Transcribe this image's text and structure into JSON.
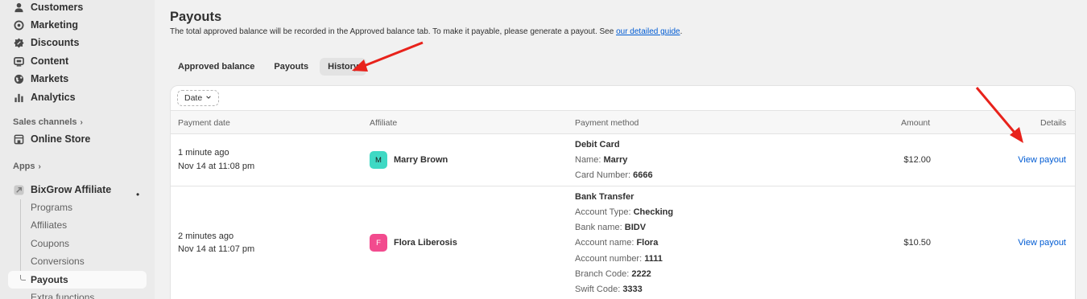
{
  "sidebar": {
    "items": [
      {
        "label": "Customers",
        "icon": "person-icon"
      },
      {
        "label": "Marketing",
        "icon": "target-icon"
      },
      {
        "label": "Discounts",
        "icon": "discount-icon"
      },
      {
        "label": "Content",
        "icon": "content-icon"
      },
      {
        "label": "Markets",
        "icon": "globe-icon"
      },
      {
        "label": "Analytics",
        "icon": "bar-chart-icon"
      }
    ],
    "sales_channels_label": "Sales channels",
    "online_store_label": "Online Store",
    "apps_label": "Apps",
    "app_name": "BixGrow Affiliate",
    "app_dot": "•",
    "sub_items": [
      "Programs",
      "Affiliates",
      "Coupons",
      "Conversions",
      "Payouts",
      "Extra functions"
    ],
    "active_sub_item": "Payouts",
    "chevron": "›"
  },
  "page": {
    "title": "Payouts",
    "subtitle": "The total approved balance will be recorded in the Approved balance tab. To make it payable, please generate a payout. See ",
    "subtitle_link": "our detailed guide",
    "subtitle_end": "."
  },
  "tabs": [
    {
      "label": "Approved balance",
      "active": false
    },
    {
      "label": "Payouts",
      "active": false
    },
    {
      "label": "History",
      "active": true
    }
  ],
  "filter": {
    "label": "Date",
    "chevron": "⌄"
  },
  "table": {
    "headers": {
      "payment_date": "Payment date",
      "affiliate": "Affiliate",
      "payment_method": "Payment method",
      "amount": "Amount",
      "details": "Details"
    },
    "rows": [
      {
        "relative_time": "1 minute ago",
        "date": "Nov 14 at 11:08 pm",
        "avatar_letter": "M",
        "avatar_color": "#3fd9c4",
        "affiliate": "Marry Brown",
        "method_title": "Debit Card",
        "method_lines": [
          {
            "label": "Name: ",
            "value": "Marry"
          },
          {
            "label": "Card Number: ",
            "value": "6666"
          }
        ],
        "amount": "$12.00",
        "action": "View payout"
      },
      {
        "relative_time": "2 minutes ago",
        "date": "Nov 14 at 11:07 pm",
        "avatar_letter": "F",
        "avatar_color": "#f24b8e",
        "affiliate": "Flora Liberosis",
        "method_title": "Bank Transfer",
        "method_lines": [
          {
            "label": "Account Type: ",
            "value": "Checking"
          },
          {
            "label": "Bank name: ",
            "value": "BIDV"
          },
          {
            "label": "Account name: ",
            "value": "Flora"
          },
          {
            "label": "Account number: ",
            "value": "1111"
          },
          {
            "label": "Branch Code: ",
            "value": "2222"
          },
          {
            "label": "Swift Code: ",
            "value": "3333"
          }
        ],
        "amount": "$10.50",
        "action": "View payout"
      }
    ]
  },
  "annotation_color": "#e8221b"
}
